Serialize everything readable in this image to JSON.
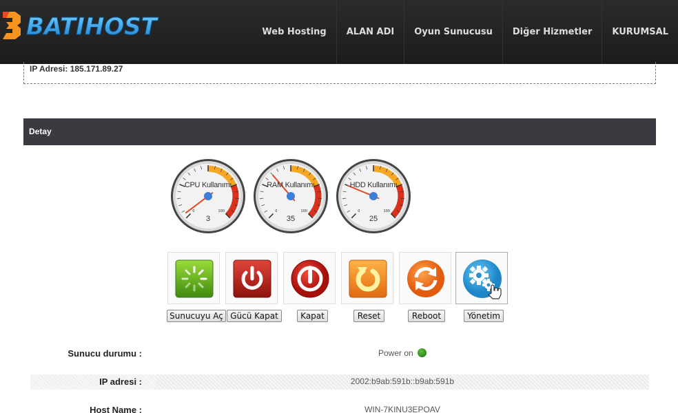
{
  "header": {
    "brand": "BATIHOST",
    "nav": [
      "Web Hosting",
      "ALAN ADI",
      "Oyun Sunucusu",
      "Diğer Hizmetler",
      "KURUMSAL"
    ]
  },
  "ip_box": {
    "text": "IP Adresi: 185.171.89.27"
  },
  "detay": {
    "title": "Detay"
  },
  "gauges": [
    {
      "label": "CPU Kullanımı",
      "value": "3",
      "min": "0",
      "max": "100",
      "level": 3
    },
    {
      "label": "RAM Kullanımı",
      "value": "35",
      "min": "0",
      "max": "100",
      "level": 35
    },
    {
      "label": "HDD Kullanımı",
      "value": "25",
      "min": "0",
      "max": "100",
      "level": 25
    }
  ],
  "actions": [
    {
      "label": "Sunucuyu Aç",
      "icon": "power-on-icon"
    },
    {
      "label": "Gücü Kapat",
      "icon": "power-off-icon"
    },
    {
      "label": "Kapat",
      "icon": "shutdown-icon"
    },
    {
      "label": "Reset",
      "icon": "reset-icon"
    },
    {
      "label": "Reboot",
      "icon": "reboot-icon"
    },
    {
      "label": "Yönetim",
      "icon": "gear-icon"
    }
  ],
  "info": {
    "status_label": "Sunucu durumu :",
    "status_value": "Power on",
    "ip_label": "IP adresi :",
    "ip_value": "2002:b9ab:591b::b9ab:591b",
    "host_label": "Host Name :",
    "host_value": "WIN-7KINU3EPOAV"
  },
  "colors": {
    "header_bg": "#232323",
    "detay_bg": "#3a3b40",
    "logo_blue": "#2aa8e8",
    "logo_orange": "#f7941d",
    "status_on": "#2e8b1a"
  }
}
